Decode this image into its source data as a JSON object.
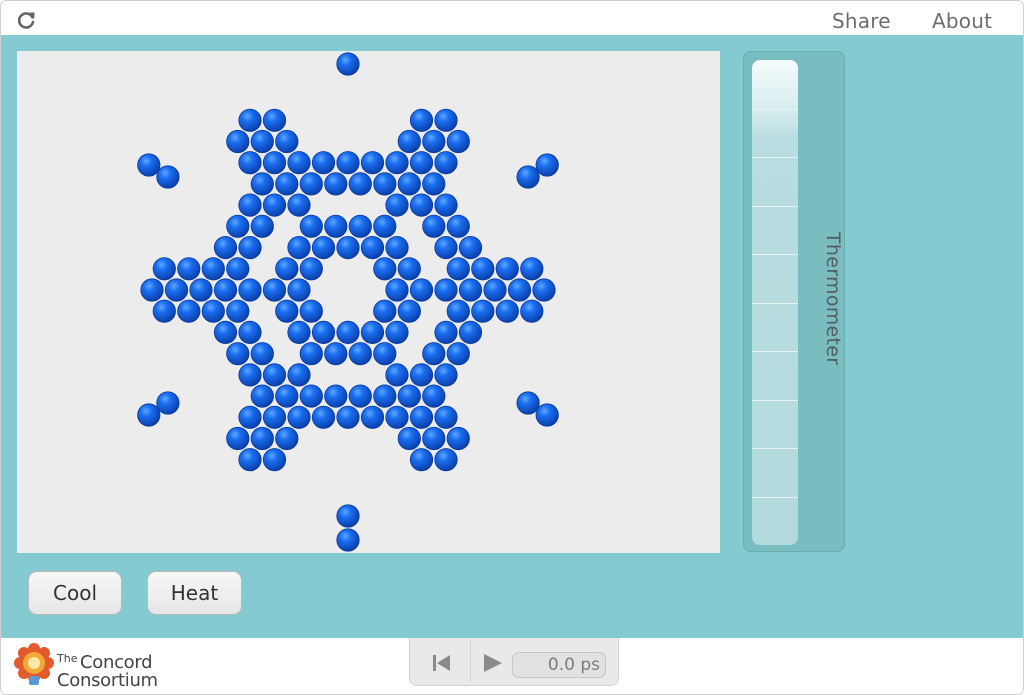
{
  "topbar": {
    "reload_icon": "reload-icon",
    "share_label": "Share",
    "about_label": "About"
  },
  "model": {
    "atom_color": "#1565d8",
    "background": "#ececec",
    "thermometer_label": "Thermometer"
  },
  "controls": {
    "cool_label": "Cool",
    "heat_label": "Heat"
  },
  "player": {
    "rewind_icon": "reset-icon",
    "play_icon": "play-icon",
    "time": "0.0 ps"
  },
  "footer": {
    "logo_line1_small": "The",
    "logo_line1": "Concord",
    "logo_line2": "Consortium"
  },
  "colors": {
    "stage": "#84cbd1",
    "thermometer_frame": "#79bdc1"
  }
}
